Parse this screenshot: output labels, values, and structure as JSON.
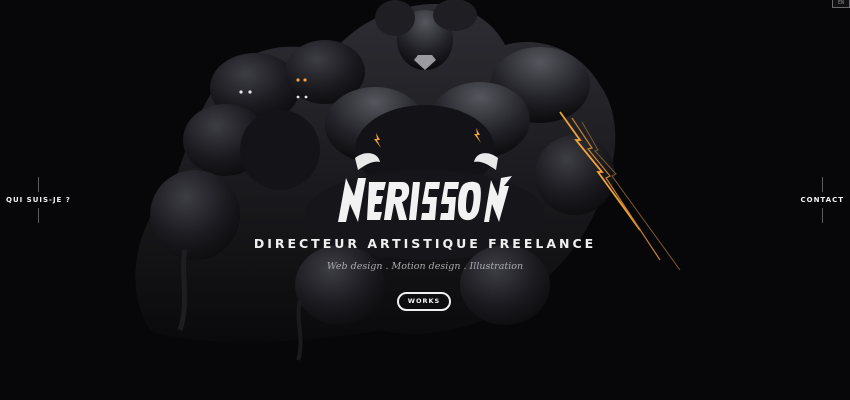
{
  "header": {
    "lang_label": "EN"
  },
  "nav": {
    "left_label": "QUI SUIS-JE ?",
    "right_label": "CONTACT"
  },
  "hero": {
    "logo_text": "NERISSON",
    "tagline": "DIRECTEUR ARTISTIQUE FREELANCE",
    "subtitle": "Web design . Motion design . Illustration",
    "cta_label": "WORKS"
  },
  "colors": {
    "background": "#070709",
    "accent": "#f0a23a",
    "text": "#f1f0f0",
    "muted": "#a9a9ae"
  }
}
